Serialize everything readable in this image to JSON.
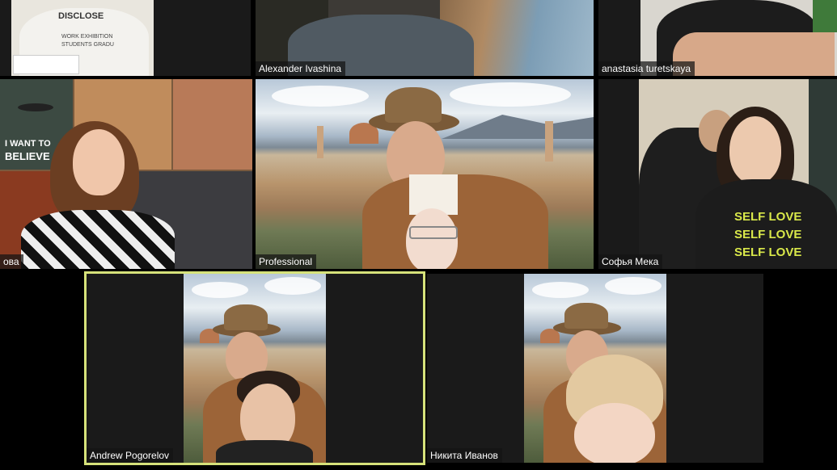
{
  "participants": [
    {
      "name": ""
    },
    {
      "name": "Alexander Ivashina"
    },
    {
      "name": "anastasia turetskaya"
    },
    {
      "name": "ова"
    },
    {
      "name": "Professional"
    },
    {
      "name": "Софья Мека"
    },
    {
      "name": "Andrew Pogorelov"
    },
    {
      "name": "Никита Иванов"
    }
  ],
  "colors": {
    "background": "#000000",
    "active_speaker_border": "#d6e27a",
    "name_label_bg": "#141414",
    "name_label_text": "#ffffff"
  },
  "posters": {
    "believe_line1": "I WANT TO",
    "believe_line2": "BELIEVE",
    "shirt_text": "DISCLOSE",
    "shirt_sub1": "WORK EXHIBITION",
    "shirt_sub2": "STUDENTS GRADU",
    "hoodie_text": "SELF LOVE"
  }
}
